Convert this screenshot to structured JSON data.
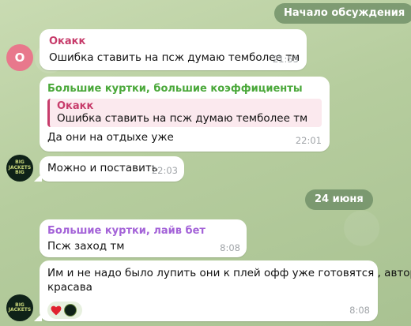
{
  "colors": {
    "accent_pink": "#c73c6b",
    "accent_green": "#4aa83a",
    "accent_purple": "#a463d8",
    "avatar_pink": "#e8788c"
  },
  "date_pills": {
    "discussion_start": "Начало обсуждения",
    "june_24": "24 июня"
  },
  "messages": [
    {
      "sender": "Окакк",
      "avatar_letter": "О",
      "text": "Ошибка ставить на псж думаю темболее тм",
      "time": "21:53"
    },
    {
      "sender": "Большие куртки, большие коэффициенты",
      "reply_to": {
        "sender": "Окакк",
        "text": "Ошибка ставить на псж думаю темболее тм"
      },
      "text": "Да они на отдыхе уже",
      "time": "22:01"
    },
    {
      "text": "Можно и поставить",
      "time": "22:03",
      "avatar_logo": "BIG JACKETS BIG"
    },
    {
      "sender": "Большие куртки, лайв бет",
      "text": "Псж заход тм",
      "time": "8:08"
    },
    {
      "text_line1": "Им и не надо было лупить они к плей офф уже готовятся , автор",
      "text_line2": "красава",
      "time": "8:08",
      "reaction_icon": "heart-icon",
      "avatar_logo": "BIG JACKETS"
    }
  ]
}
